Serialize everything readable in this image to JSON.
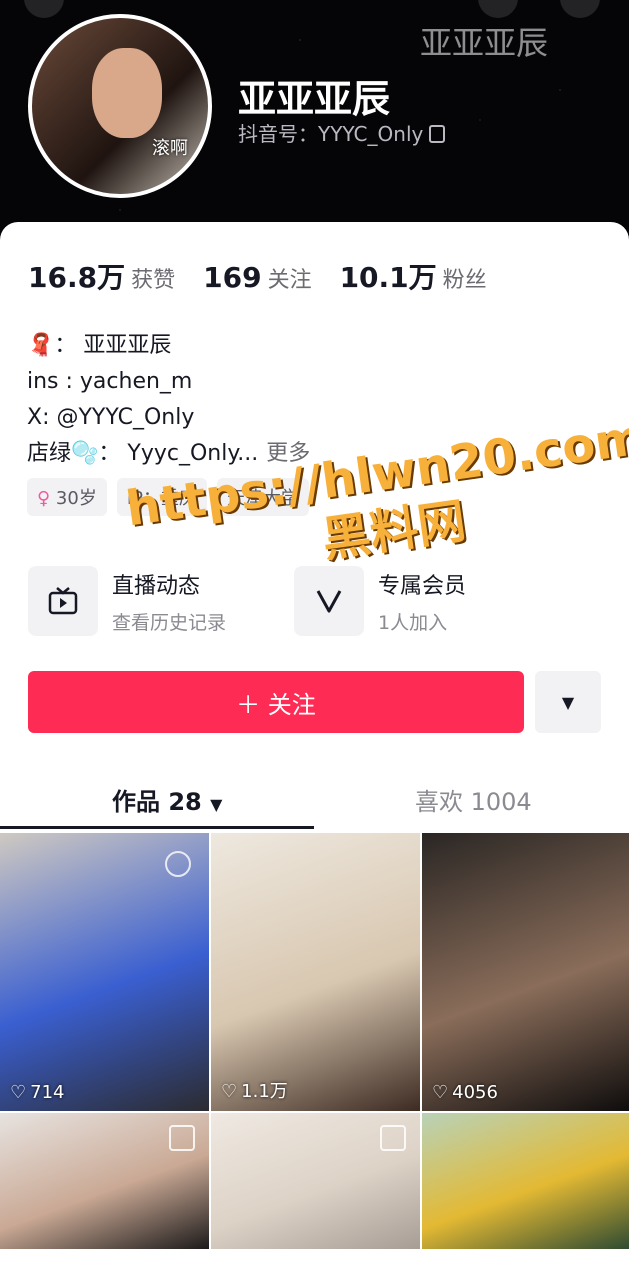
{
  "profile": {
    "name": "亚亚亚辰",
    "douyin_id": "抖音号：YYYC_Only",
    "avatar_caption": "滚啊",
    "watermark": "亚亚亚辰"
  },
  "stats": [
    {
      "value": "16.8万",
      "label": "获赞"
    },
    {
      "value": "169",
      "label": "关注"
    },
    {
      "value": "10.1万",
      "label": "粉丝"
    }
  ],
  "bio": {
    "line1": "🧣：  亚亚亚辰",
    "line2": "ins : yachen_m",
    "line3": "X:    @YYYC_Only",
    "line4": "店绿🫧：  Yyyc_Only...",
    "more": "更多"
  },
  "tags": [
    {
      "icon": "♀",
      "text": "30岁"
    },
    {
      "text": "IP：重庆"
    },
    {
      "text": "天津大学"
    }
  ],
  "overlay": {
    "url": "https://hlwn20.com",
    "site_name": "黑料网"
  },
  "actions": {
    "live": {
      "title": "直播动态",
      "subtitle": "查看历史记录"
    },
    "member": {
      "title": "专属会员",
      "subtitle": "1人加入"
    }
  },
  "buttons": {
    "follow": "＋ 关注"
  },
  "tabs": {
    "works": "作品 28",
    "likes": "喜欢 1004"
  },
  "posts": [
    {
      "likes": "714",
      "colors": [
        "#cfc9c2",
        "#2b2b30",
        "#3a5fd0"
      ]
    },
    {
      "likes": "1.1万",
      "colors": [
        "#eee8df",
        "#3d2a22",
        "#d8c7b0"
      ]
    },
    {
      "likes": "4056",
      "colors": [
        "#2a2624",
        "#0e0c0c",
        "#8a6d5a"
      ]
    },
    {
      "likes": "",
      "colors": [
        "#e7e3e0",
        "#1c1a1a",
        "#caa995"
      ]
    },
    {
      "likes": "",
      "colors": [
        "#efe9e2",
        "#a79d95",
        "#ddd2c6"
      ]
    },
    {
      "likes": "",
      "colors": [
        "#b8d2b8",
        "#2d4a32",
        "#e3b933"
      ]
    }
  ],
  "icons": {
    "tv": "tv-icon",
    "vip": "v-icon",
    "heart": "heart-icon"
  },
  "colors": {
    "follow": "#fe2c55",
    "text_primary": "#161823"
  }
}
